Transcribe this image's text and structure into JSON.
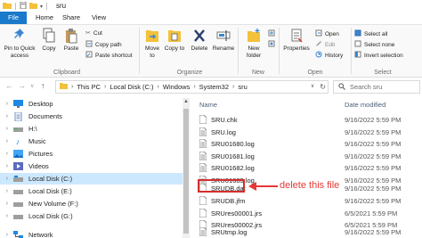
{
  "window": {
    "title": "sru"
  },
  "tabs": [
    "File",
    "Home",
    "Share",
    "View"
  ],
  "ribbon": {
    "clipboard": {
      "label": "Clipboard",
      "pin": "Pin to Quick access",
      "copy": "Copy",
      "paste": "Paste",
      "cut": "Cut",
      "copy_path": "Copy path",
      "paste_shortcut": "Paste shortcut"
    },
    "organize": {
      "label": "Organize",
      "move_to": "Move to",
      "copy_to": "Copy to",
      "delete": "Delete",
      "rename": "Rename"
    },
    "new": {
      "label": "New",
      "new_folder": "New folder"
    },
    "open": {
      "label": "Open",
      "properties": "Properties",
      "open": "Open",
      "edit": "Edit",
      "history": "History"
    },
    "select": {
      "label": "Select",
      "select_all": "Select all",
      "select_none": "Select none",
      "invert_selection": "Invert selection"
    }
  },
  "address": {
    "path": [
      "This PC",
      "Local Disk (C:)",
      "Windows",
      "System32",
      "sru"
    ],
    "search_placeholder": "Search sru"
  },
  "nav_pane": {
    "items": [
      {
        "label": "Desktop",
        "icon": "desktop-icon",
        "expandable": true
      },
      {
        "label": "Documents",
        "icon": "documents-icon",
        "expandable": true
      },
      {
        "label": "H:\\",
        "icon": "drive-icon",
        "expandable": true
      },
      {
        "label": "Music",
        "icon": "music-icon",
        "expandable": true
      },
      {
        "label": "Pictures",
        "icon": "pictures-icon",
        "expandable": true
      },
      {
        "label": "Videos",
        "icon": "videos-icon",
        "expandable": true
      },
      {
        "label": "Local Disk (C:)",
        "icon": "drive-icon",
        "expandable": true,
        "selected": true
      },
      {
        "label": "Local Disk (E:)",
        "icon": "drive-icon",
        "expandable": true
      },
      {
        "label": "New Volume (F:)",
        "icon": "drive-icon",
        "expandable": true
      },
      {
        "label": "Local Disk (G:)",
        "icon": "drive-icon",
        "expandable": true
      },
      {
        "label": "Network",
        "icon": "network-icon",
        "expandable": true
      }
    ]
  },
  "file_list": {
    "columns": {
      "name": "Name",
      "date": "Date modified"
    },
    "files": [
      {
        "name": "SRU.chk",
        "date": "9/16/2022 5:59 PM"
      },
      {
        "name": "SRU.log",
        "date": "9/16/2022 5:59 PM"
      },
      {
        "name": "SRU01680.log",
        "date": "9/16/2022 5:59 PM"
      },
      {
        "name": "SRU01681.log",
        "date": "9/16/2022 5:59 PM"
      },
      {
        "name": "SRU01682.log",
        "date": "9/16/2022 5:59 PM"
      },
      {
        "name": "SRU01683.log",
        "date": "9/16/2022 5:59 PM"
      },
      {
        "name": "SRUDB.dat",
        "date": "9/16/2022 5:59 PM"
      },
      {
        "name": "SRUDB.jfm",
        "date": "9/16/2022 5:59 PM"
      },
      {
        "name": "SRUres00001.jrs",
        "date": "6/5/2021 5:59 PM"
      },
      {
        "name": "SRUres00002.jrs",
        "date": "6/5/2021 5:59 PM"
      },
      {
        "name": "SRUtmp.log",
        "date": "9/16/2022 5:59 PM"
      }
    ]
  },
  "annotation": {
    "text": "delete this file",
    "color": "#e53935"
  }
}
